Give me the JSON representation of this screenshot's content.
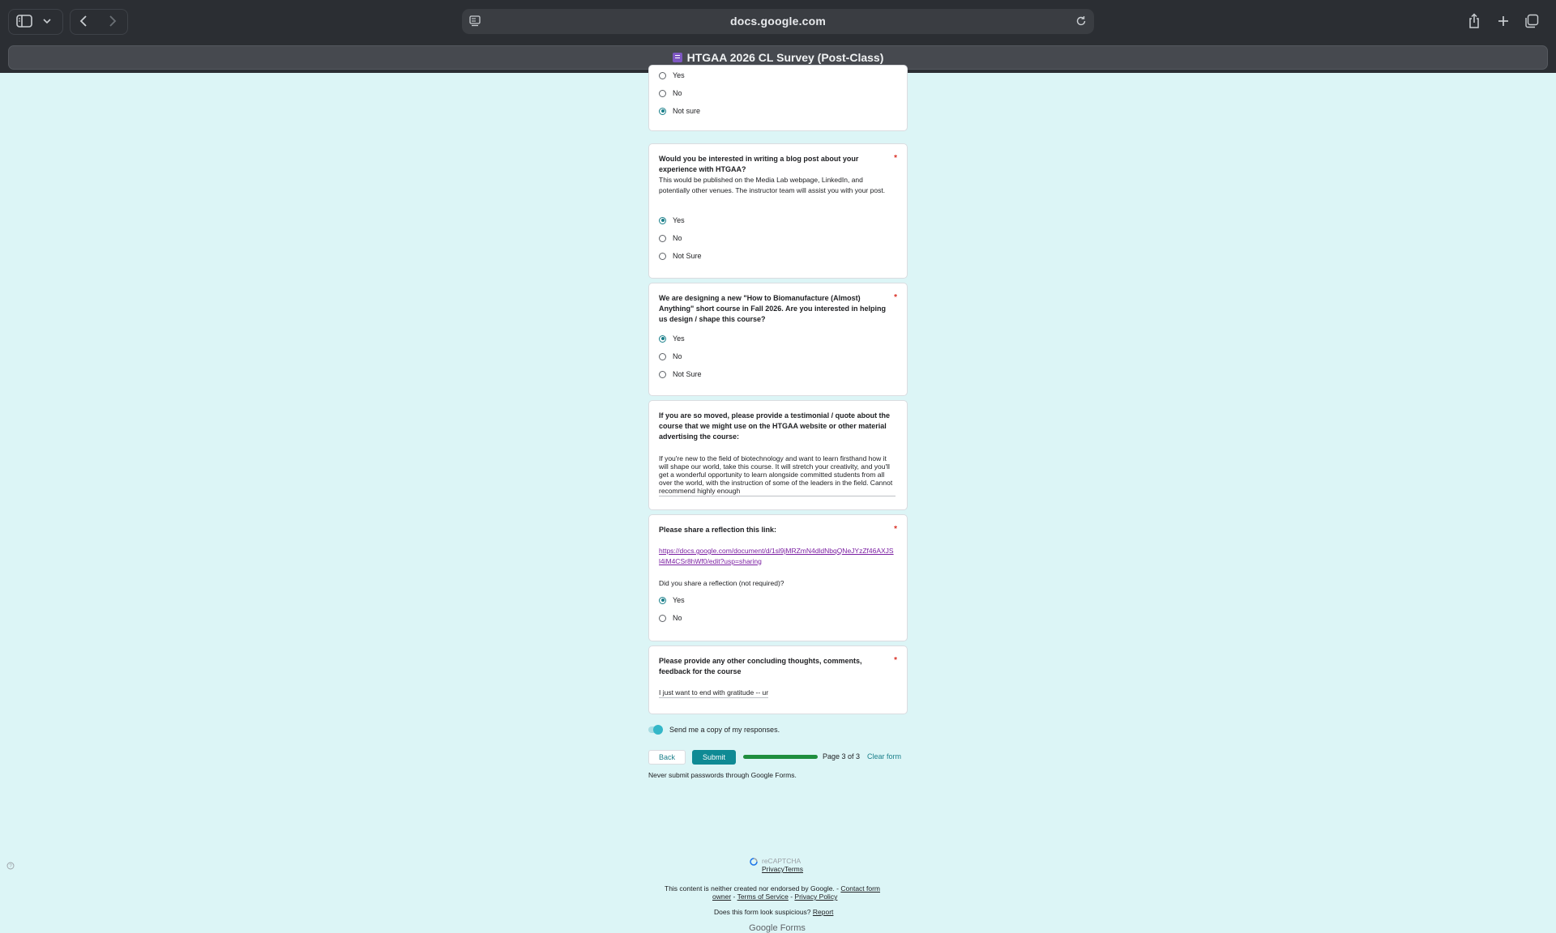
{
  "browser": {
    "url": "docs.google.com",
    "tab_title": "HTGAA 2026 CL Survey (Post-Class)"
  },
  "q_prev": {
    "options": [
      {
        "label": "Yes",
        "selected": false
      },
      {
        "label": "No",
        "selected": false
      },
      {
        "label": "Not sure",
        "selected": true
      }
    ]
  },
  "q_blog": {
    "title": "Would you be interested in writing a blog post about your experience with HTGAA?",
    "required": "*",
    "description": "This would be published on the Media Lab webpage, LinkedIn, and potentially other venues. The instructor team will assist you with your post.",
    "options": [
      {
        "label": "Yes",
        "selected": true
      },
      {
        "label": "No",
        "selected": false
      },
      {
        "label": "Not Sure",
        "selected": false
      }
    ]
  },
  "q_course": {
    "title": "We are designing a new \"How to Biomanufacture (Almost) Anything\" short course in Fall 2026. Are you interested in helping us design / shape this course?",
    "required": "*",
    "options": [
      {
        "label": "Yes",
        "selected": true
      },
      {
        "label": "No",
        "selected": false
      },
      {
        "label": "Not Sure",
        "selected": false
      }
    ]
  },
  "q_testimonial": {
    "title": "If you are so moved, please provide a testimonial / quote about the course that we might use on the HTGAA website or other material advertising the course:",
    "answer": "If you're new to the field of biotechnology and want to learn firsthand how it will shape our world, take this course. It will stretch your creativity, and you'll get a wonderful opportunity to learn alongside committed students from all over the world, with the instruction of some of the leaders in the field. Cannot recommend highly enough"
  },
  "q_reflection": {
    "title": "Please share a reflection this link:",
    "required": "*",
    "link": "https://docs.google.com/document/d/1sl9jMRZmN4dldNbqQNeJYzZf46AXJSl4iM4CSr8hWf0/edit?usp=sharing",
    "subquestion": "Did you share a reflection (not required)?",
    "options": [
      {
        "label": "Yes",
        "selected": true
      },
      {
        "label": "No",
        "selected": false
      }
    ]
  },
  "q_concluding": {
    "title": "Please provide any other concluding thoughts, comments, feedback for the course",
    "required": "*",
    "answer": "I just want to end with gratitude -- ur"
  },
  "controls": {
    "send_copy": "Send me a copy of my responses.",
    "back": "Back",
    "submit": "Submit",
    "page_indicator": "Page 3 of 3",
    "progress": 1.0,
    "clear": "Clear form"
  },
  "footer": {
    "passwords": "Never submit passwords through Google Forms.",
    "recaptcha": "reCAPTCHA",
    "privacy": "Privacy",
    "terms": "Terms",
    "disclaimer": "This content is neither created nor endorsed by Google. -",
    "contact_a": "Contact form",
    "contact_b": "owner",
    "tos": "Terms of Service",
    "privacy_policy": "Privacy Policy",
    "suspicious": "Does this form look suspicious?",
    "report": "Report",
    "brand_google": "Google",
    "brand_forms": "Forms"
  },
  "icons": [
    "sidebar-icon",
    "chevron-down-icon",
    "back-arrow-icon",
    "forward-arrow-icon",
    "reader-icon",
    "reload-icon",
    "share-icon",
    "new-tab-icon",
    "tabs-overview-icon",
    "help-icon",
    "recaptcha-icon"
  ]
}
